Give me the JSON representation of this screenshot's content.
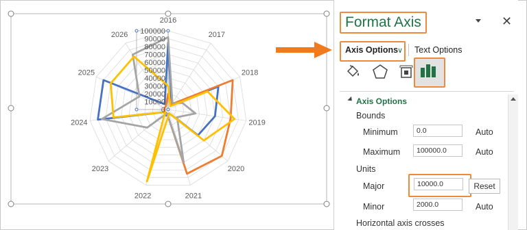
{
  "chart_data": {
    "type": "radar",
    "categories": [
      "2016",
      "2017",
      "2018",
      "2019",
      "2020",
      "2021",
      "2022",
      "2023",
      "2024",
      "2025",
      "2026"
    ],
    "tick_labels": [
      "0",
      "10000",
      "20000",
      "30000",
      "40000",
      "50000",
      "60000",
      "70000",
      "80000",
      "90000",
      "100000"
    ],
    "ylim": [
      0,
      100000
    ],
    "grid": true,
    "series": [
      {
        "color": "#4472c4",
        "values": [
          85000,
          8000,
          70000,
          60000,
          50000,
          5000,
          8000,
          5000,
          90000,
          90000,
          8000
        ]
      },
      {
        "color": "#ed7d31",
        "values": [
          20000,
          8000,
          90000,
          80000,
          90000,
          85000,
          5000,
          5000,
          5000,
          5000,
          5000
        ]
      },
      {
        "color": "#a5a5a5",
        "values": [
          92000,
          10000,
          20000,
          35000,
          15000,
          70000,
          5000,
          35000,
          85000,
          40000,
          83000
        ]
      },
      {
        "color": "#ffc000",
        "values": [
          30000,
          5000,
          55000,
          85000,
          60000,
          5000,
          95000,
          5000,
          70000,
          80000,
          80000
        ]
      }
    ]
  },
  "pane": {
    "title": "Format Axis",
    "close_glyph": "✕",
    "tab_axis": "Axis Options",
    "tab_chevron": "∨",
    "tab_text": "Text Options",
    "section_title": "Axis Options",
    "bounds_label": "Bounds",
    "minimum_label": "Minimum",
    "minimum_value": "0.0",
    "minimum_auto": "Auto",
    "maximum_label": "Maximum",
    "maximum_value": "100000.0",
    "maximum_auto": "Auto",
    "units_label": "Units",
    "major_label": "Major",
    "major_value": "10000.0",
    "reset_label": "Reset",
    "minor_label": "Minor",
    "minor_value": "2000.0",
    "minor_auto": "Auto",
    "crosses_label": "Horizontal axis crosses"
  },
  "icons": [
    "fill-line-icon",
    "effects-icon",
    "size-properties-icon",
    "axis-options-icon"
  ],
  "colors": {
    "accent": "#217346",
    "highlight": "#ee8a3a",
    "arrow": "#f07b1c"
  }
}
